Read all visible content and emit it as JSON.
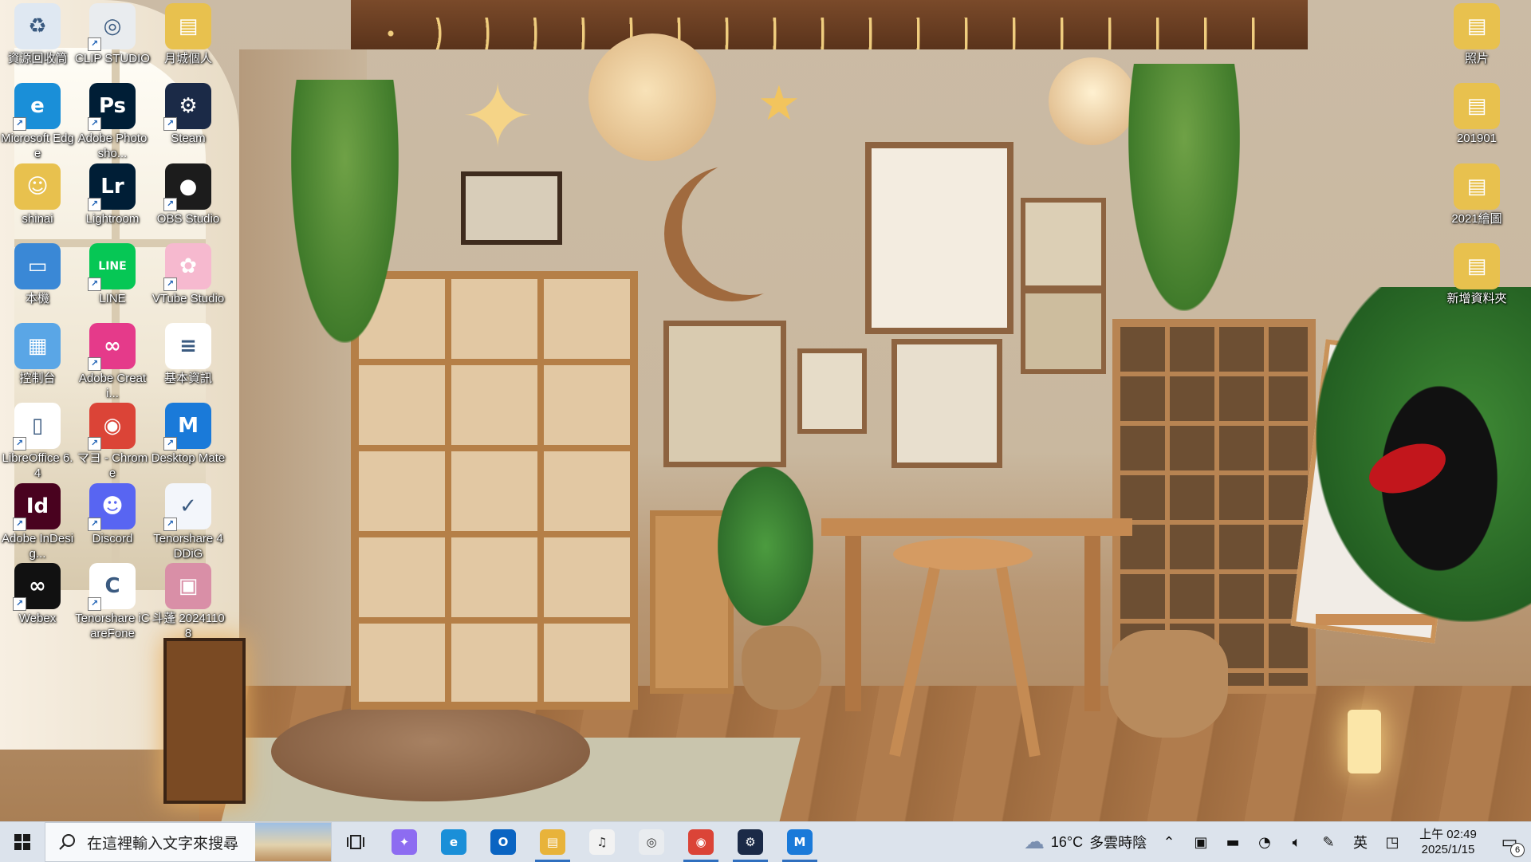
{
  "desktop": {
    "icons": [
      {
        "id": "recycle-bin",
        "label": "資源回收筒",
        "icon": "recycle-bin-icon",
        "color": "#dfe8f2",
        "glyph": "♻",
        "shortcut": false
      },
      {
        "id": "clip-studio",
        "label": "CLIP STUDIO",
        "icon": "clip-studio-icon",
        "color": "#e9ecef",
        "glyph": "◎",
        "shortcut": true
      },
      {
        "id": "monthly-folder",
        "label": "月城個人",
        "icon": "folder-icon",
        "color": "#e8c14e",
        "glyph": "▤",
        "shortcut": false
      },
      {
        "id": "edge",
        "label": "Microsoft Edge",
        "icon": "edge-icon",
        "color": "#1a8fd8",
        "glyph": "e",
        "shortcut": true
      },
      {
        "id": "photoshop",
        "label": "Adobe Photosho...",
        "icon": "photoshop-icon",
        "color": "#001e36",
        "glyph": "Ps",
        "shortcut": true
      },
      {
        "id": "steam",
        "label": "Steam",
        "icon": "steam-icon",
        "color": "#1b2a47",
        "glyph": "⚙",
        "shortcut": true
      },
      {
        "id": "shinai",
        "label": "shinai",
        "icon": "user-folder-icon",
        "color": "#e8c14e",
        "glyph": "☺",
        "shortcut": false
      },
      {
        "id": "lightroom",
        "label": "Lightroom",
        "icon": "lightroom-icon",
        "color": "#001e36",
        "glyph": "Lr",
        "shortcut": true
      },
      {
        "id": "obs",
        "label": "OBS Studio",
        "icon": "obs-icon",
        "color": "#1c1c1c",
        "glyph": "●",
        "shortcut": true
      },
      {
        "id": "this-pc",
        "label": "本機",
        "icon": "computer-icon",
        "color": "#3a88d6",
        "glyph": "▭",
        "shortcut": false
      },
      {
        "id": "line",
        "label": "LINE",
        "icon": "line-icon",
        "color": "#06c755",
        "glyph": "LINE",
        "shortcut": true
      },
      {
        "id": "vtube",
        "label": "VTube Studio",
        "icon": "vtube-studio-icon",
        "color": "#f6b9cf",
        "glyph": "✿",
        "shortcut": true
      },
      {
        "id": "control-panel",
        "label": "控制台",
        "icon": "control-panel-icon",
        "color": "#5aa6e6",
        "glyph": "▦",
        "shortcut": false
      },
      {
        "id": "creative-cloud",
        "label": "Adobe Creati...",
        "icon": "creative-cloud-icon",
        "color": "#e53a8a",
        "glyph": "∞",
        "shortcut": true
      },
      {
        "id": "basic-info",
        "label": "基本資訊",
        "icon": "text-document-icon",
        "color": "#ffffff",
        "glyph": "≡",
        "shortcut": false
      },
      {
        "id": "libreoffice",
        "label": "LibreOffice 6.4",
        "icon": "libreoffice-icon",
        "color": "#ffffff",
        "glyph": "▯",
        "shortcut": true
      },
      {
        "id": "chrome",
        "label": "マヨ - Chrome",
        "icon": "chrome-icon",
        "color": "#db4437",
        "glyph": "◉",
        "shortcut": true
      },
      {
        "id": "desktop-mate",
        "label": "Desktop Mate",
        "icon": "desktop-mate-icon",
        "color": "#1a7ad9",
        "glyph": "M",
        "shortcut": true
      },
      {
        "id": "indesign",
        "label": "Adobe InDesig...",
        "icon": "indesign-icon",
        "color": "#49021f",
        "glyph": "Id",
        "shortcut": true
      },
      {
        "id": "discord",
        "label": "Discord",
        "icon": "discord-icon",
        "color": "#5865f2",
        "glyph": "☻",
        "shortcut": true
      },
      {
        "id": "tenorshare-4ddig",
        "label": "Tenorshare 4DDiG",
        "icon": "tenorshare-4ddig-icon",
        "color": "#f3f6fb",
        "glyph": "✓",
        "shortcut": true
      },
      {
        "id": "webex",
        "label": "Webex",
        "icon": "webex-icon",
        "color": "#111111",
        "glyph": "∞",
        "shortcut": true
      },
      {
        "id": "icarefone",
        "label": "Tenorshare iCareFone",
        "icon": "icarefone-icon",
        "color": "#ffffff",
        "glyph": "C",
        "shortcut": true
      },
      {
        "id": "doujin-image",
        "label": "斗蓬 20241108",
        "icon": "image-file-icon",
        "color": "#d98fa7",
        "glyph": "▣",
        "shortcut": false
      },
      {
        "id": "photos",
        "label": "照片",
        "icon": "folder-icon",
        "color": "#e8c14e",
        "glyph": "▤",
        "shortcut": false
      },
      {
        "id": "folder-201901",
        "label": "201901",
        "icon": "folder-icon",
        "color": "#e8c14e",
        "glyph": "▤",
        "shortcut": false
      },
      {
        "id": "folder-2021",
        "label": "2021繪圖",
        "icon": "folder-icon",
        "color": "#e8c14e",
        "glyph": "▤",
        "shortcut": false
      },
      {
        "id": "new-folder",
        "label": "新增資料夾",
        "icon": "folder-icon",
        "color": "#e8c14e",
        "glyph": "▤",
        "shortcut": false
      }
    ]
  },
  "taskbar": {
    "start_icon": "windows-start-icon",
    "search_placeholder": "在這裡輸入文字來搜尋",
    "task_view_icon": "task-view-icon",
    "apps": [
      {
        "id": "copilot",
        "icon": "copilot-icon",
        "color": "#8d6cf1",
        "glyph": "✦",
        "active": false
      },
      {
        "id": "edge",
        "icon": "edge-icon",
        "color": "#1a8fd8",
        "glyph": "e",
        "active": false
      },
      {
        "id": "outlook",
        "icon": "outlook-icon",
        "color": "#0a64c2",
        "glyph": "O",
        "active": false
      },
      {
        "id": "file-explorer",
        "icon": "file-explorer-icon",
        "color": "#e8b33a",
        "glyph": "▤",
        "active": true
      },
      {
        "id": "itunes",
        "icon": "itunes-icon",
        "color": "#f2f2f2",
        "glyph": "♫",
        "active": false
      },
      {
        "id": "clip-studio",
        "icon": "clip-studio-icon",
        "color": "#e9ecef",
        "glyph": "◎",
        "active": false
      },
      {
        "id": "chrome",
        "icon": "chrome-icon",
        "color": "#db4437",
        "glyph": "◉",
        "active": true
      },
      {
        "id": "steam",
        "icon": "steam-icon",
        "color": "#1b2a47",
        "glyph": "⚙",
        "active": true
      },
      {
        "id": "desktop-mate",
        "icon": "desktop-mate-icon",
        "color": "#1a7ad9",
        "glyph": "M",
        "active": true
      }
    ],
    "weather": {
      "temp": "16°C",
      "condition": "多雲時陰",
      "icon": "cloudy-weather-icon"
    },
    "tray": {
      "chevron_icon": "chevron-up-icon",
      "icons": [
        "meet-now-icon",
        "battery-icon",
        "wifi-icon",
        "volume-icon",
        "pen-icon"
      ],
      "ime": "英",
      "ime_mode_icon": "input-mode-icon"
    },
    "clock": {
      "time": "上午 02:49",
      "date": "2025/1/15"
    },
    "notifications": {
      "count": "6",
      "icon": "notification-center-icon"
    }
  }
}
